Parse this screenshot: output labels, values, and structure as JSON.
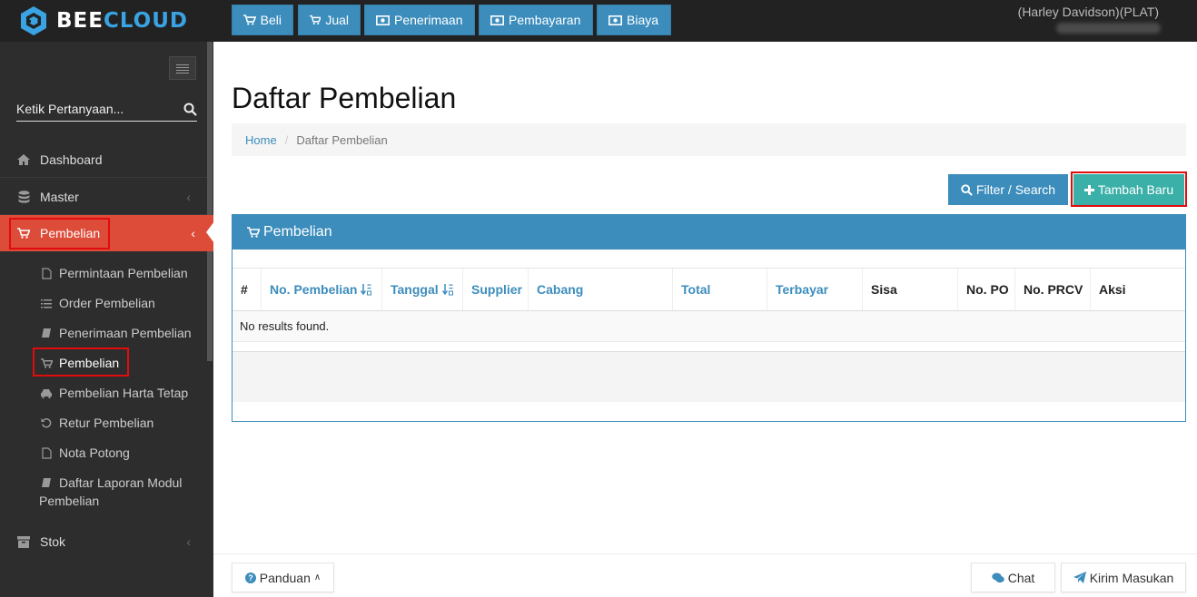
{
  "brand": {
    "part1": "BEE",
    "part2": "CLOUD"
  },
  "topnav": [
    {
      "label": "Beli",
      "icon": "cart-icon"
    },
    {
      "label": "Jual",
      "icon": "cart-icon"
    },
    {
      "label": "Penerimaan",
      "icon": "money-icon"
    },
    {
      "label": "Pembayaran",
      "icon": "money-icon"
    },
    {
      "label": "Biaya",
      "icon": "money-icon"
    }
  ],
  "user": {
    "company": "(Harley Davidson)(PLAT)"
  },
  "sidebar": {
    "search_placeholder": "Ketik Pertanyaan...",
    "menu": [
      {
        "label": "Dashboard",
        "icon": "home-icon"
      },
      {
        "label": "Master",
        "icon": "database-icon"
      },
      {
        "label": "Pembelian",
        "icon": "cart-icon",
        "active": true
      },
      {
        "label": "Stok",
        "icon": "archive-icon"
      }
    ],
    "submenu": [
      {
        "label": "Permintaan Pembelian",
        "icon": "file-icon"
      },
      {
        "label": "Order Pembelian",
        "icon": "list-icon"
      },
      {
        "label": "Penerimaan Pembelian",
        "icon": "book-icon"
      },
      {
        "label": "Pembelian",
        "icon": "cart-icon",
        "active": true
      },
      {
        "label": "Pembelian Harta Tetap",
        "icon": "car-icon"
      },
      {
        "label": "Retur Pembelian",
        "icon": "undo-icon"
      },
      {
        "label": "Nota Potong",
        "icon": "file-icon"
      },
      {
        "label": "Daftar Laporan Modul",
        "label2": "Pembelian",
        "icon": "book-icon"
      }
    ]
  },
  "page": {
    "title": "Daftar Pembelian",
    "breadcrumb": {
      "home": "Home",
      "separator": "/",
      "current": "Daftar Pembelian"
    },
    "filter_button": "Filter / Search",
    "add_button": "Tambah Baru"
  },
  "panel": {
    "title": "Pembelian",
    "columns": [
      "#",
      "No. Pembelian",
      "Tanggal",
      "Supplier",
      "Cabang",
      "Total",
      "Terbayar",
      "Sisa",
      "No. PO",
      "No. PRCV",
      "Aksi"
    ],
    "empty_text": "No results found."
  },
  "footer": {
    "guide": "Panduan",
    "chat": "Chat",
    "feedback": "Kirim Masukan"
  },
  "colors": {
    "primary": "#3c8dbc",
    "active_menu": "#dd4b39",
    "success": "#3ab0a8",
    "highlight": "#e10c0c",
    "topbar": "#222222",
    "sidebar": "#2d2d2d"
  }
}
